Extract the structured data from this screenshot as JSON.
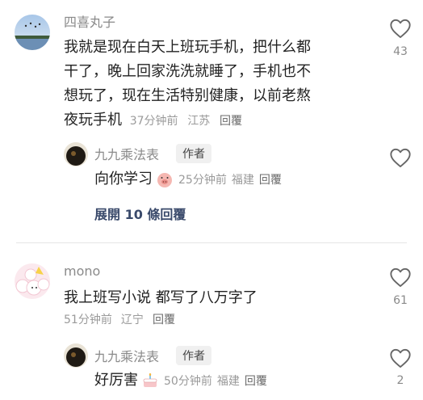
{
  "comments": [
    {
      "username": "四喜丸子",
      "text_lines": [
        "我就是现在白天上班玩手机，把什么都",
        "干了，晚上回家洗洗就睡了，手机也不",
        "想玩了，现在生活特别健康，以前老熬",
        "夜玩手机"
      ],
      "time": "37分钟前",
      "location": "江苏",
      "reply_label": "回覆",
      "likes": "43",
      "reply": {
        "username": "九九乘法表",
        "badge": "作者",
        "text": "向你学习",
        "time": "25分钟前",
        "location": "福建",
        "reply_label": "回覆",
        "likes": ""
      },
      "expand_label": "展開 10 條回覆"
    },
    {
      "username": "mono",
      "text_lines": [
        "我上班写小说 都写了八万字了"
      ],
      "time": "51分钟前",
      "location": "辽宁",
      "reply_label": "回覆",
      "likes": "61",
      "reply": {
        "username": "九九乘法表",
        "badge": "作者",
        "text": "好厉害",
        "time": "50分钟前",
        "location": "福建",
        "reply_label": "回覆",
        "likes": "2"
      }
    }
  ],
  "icons": {
    "like": "heart-outline-icon",
    "sticker_1": "pig-emoji-icon",
    "sticker_2": "cake-emoji-icon"
  },
  "colors": {
    "expand_link": "#3a4a6b",
    "meta": "#9a9a9a"
  }
}
